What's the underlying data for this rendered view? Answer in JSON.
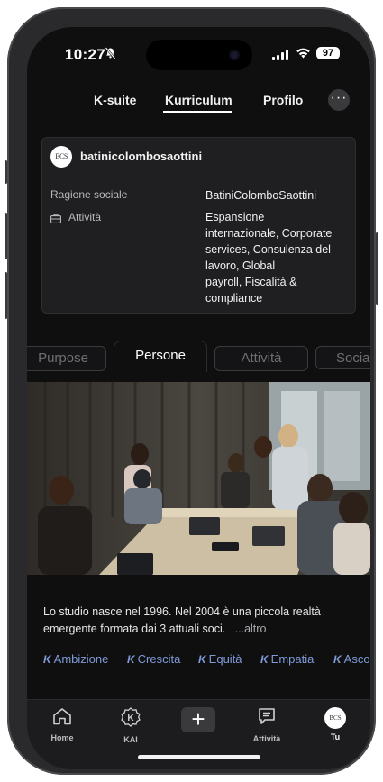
{
  "status": {
    "time": "10:27",
    "battery": "97"
  },
  "nav": {
    "tabs": [
      "K-suite",
      "Kurriculum",
      "Profilo"
    ],
    "active": "Kurriculum",
    "more": "···"
  },
  "card": {
    "logo_text": "BCS",
    "company": "batinicolombosaottini",
    "ragione_label": "Ragione sociale",
    "ragione_value": "BatiniColomboSaottini",
    "attivita_label": "Attività",
    "attivita_lines": [
      "Espansione",
      "internazionale, Corporate",
      "services, Consulenza del",
      "lavoro, Global",
      "payroll, Fiscalità &",
      "compliance"
    ]
  },
  "section_tabs": [
    "Purpose",
    "Persone",
    "Attività",
    "Social"
  ],
  "section_active": "Persone",
  "description": {
    "text": "Lo studio nasce nel 1996. Nel 2004 è una piccola realtà emergente formata dai 3 attuali soci.",
    "more": "...altro"
  },
  "values": {
    "prefix": "K",
    "items": [
      "Ambizione",
      "Crescita",
      "Equità",
      "Empatia",
      "Ascolto"
    ]
  },
  "tabbar": {
    "items": [
      "Home",
      "KAI",
      "Attività",
      "Tu"
    ],
    "plus": "+",
    "kai_icon": "K",
    "avatar": "BCS"
  },
  "colors": {
    "accent": "#7e9bd8",
    "background": "#0f0f10",
    "card": "#1f1f21"
  }
}
